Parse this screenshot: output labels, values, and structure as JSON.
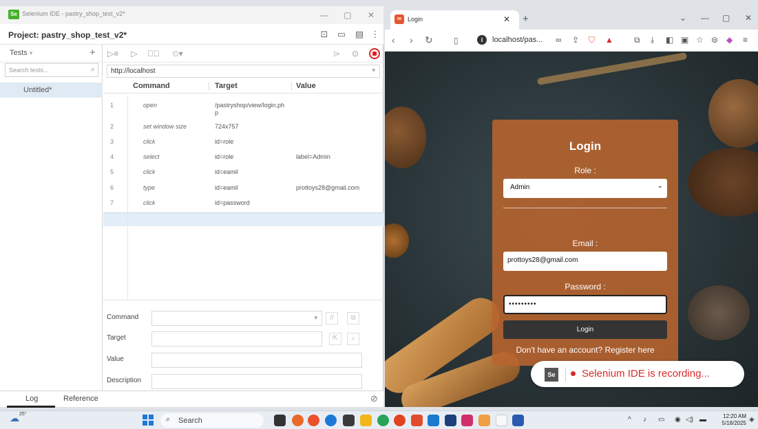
{
  "ide": {
    "window_title": "Selenium IDE - pastry_shop_test_v2*",
    "app_icon": "Se",
    "project_label": "Project: pastry_shop_test_v2*",
    "tests_label": "Tests",
    "search_placeholder": "Search tests...",
    "test_name": "Untitled*",
    "base_url": "http://localhost",
    "columns": {
      "command": "Command",
      "target": "Target",
      "value": "Value"
    },
    "commands": [
      {
        "n": "1",
        "command": "open",
        "target": "/pastryshop/view/login.php",
        "value": ""
      },
      {
        "n": "2",
        "command": "set window size",
        "target": "724x757",
        "value": ""
      },
      {
        "n": "3",
        "command": "click",
        "target": "id=role",
        "value": ""
      },
      {
        "n": "4",
        "command": "select",
        "target": "id=role",
        "value": "label=Admin"
      },
      {
        "n": "5",
        "command": "click",
        "target": "id=eamil",
        "value": ""
      },
      {
        "n": "6",
        "command": "type",
        "target": "id=eamil",
        "value": "prottoys28@gmail.com"
      },
      {
        "n": "7",
        "command": "click",
        "target": "id=password",
        "value": ""
      }
    ],
    "editor": {
      "command_label": "Command",
      "target_label": "Target",
      "value_label": "Value",
      "description_label": "Description"
    },
    "bottom_tabs": {
      "log": "Log",
      "reference": "Reference"
    }
  },
  "browser": {
    "tab_title": "Login",
    "url": "localhost/pas...",
    "login": {
      "title": "Login",
      "role_label": "Role :",
      "role_selected": "Admin",
      "email_label": "Email :",
      "email_value": "prottoys28@gmail.com",
      "password_label": "Password :",
      "password_value": "•••••••••",
      "login_button": "Login",
      "register_text": "Don't have an account? Register here"
    },
    "recording_text": "Selenium IDE is recording...",
    "recording_badge": "Se"
  },
  "taskbar": {
    "weather_temp": "25°",
    "search_label": "Search",
    "time": "12:20 AM",
    "date": "5/18/2025"
  },
  "colors": {
    "recording_red": "#d92a2a",
    "login_card": "#b9642d",
    "selection_blue": "#e0eaf4"
  }
}
